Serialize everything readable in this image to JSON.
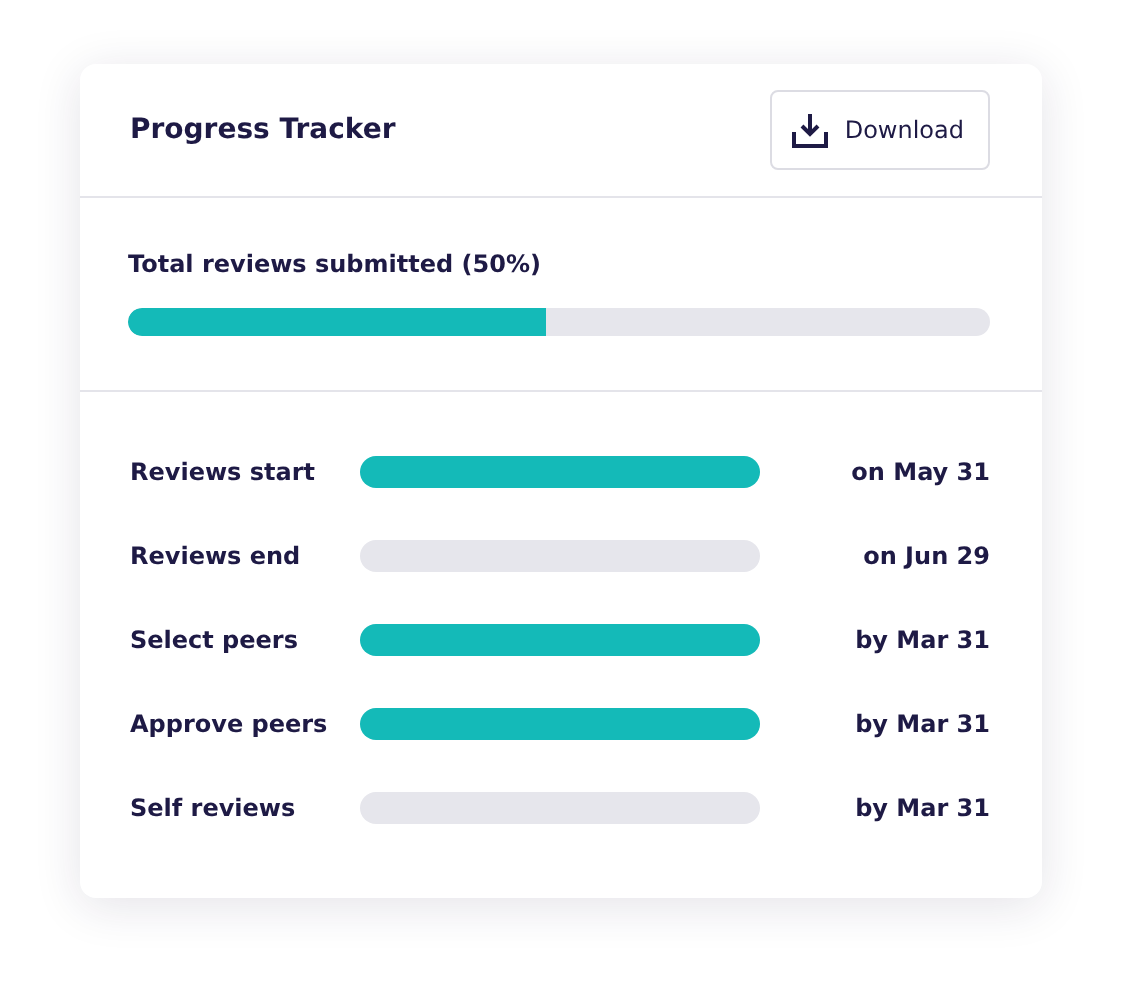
{
  "card": {
    "title": "Progress Tracker",
    "download_button": "Download"
  },
  "total": {
    "label": "Total reviews submitted (50%)",
    "level": 0.485
  },
  "milestones": [
    {
      "name": "Reviews start",
      "done": true,
      "date": "on May 31"
    },
    {
      "name": "Reviews end",
      "done": false,
      "date": "on Jun 29"
    },
    {
      "name": "Select peers",
      "done": true,
      "date": "by Mar 31"
    },
    {
      "name": "Approve peers",
      "done": true,
      "date": "by Mar 31"
    },
    {
      "name": "Self reviews",
      "done": false,
      "date": "by Mar 31"
    }
  ]
}
